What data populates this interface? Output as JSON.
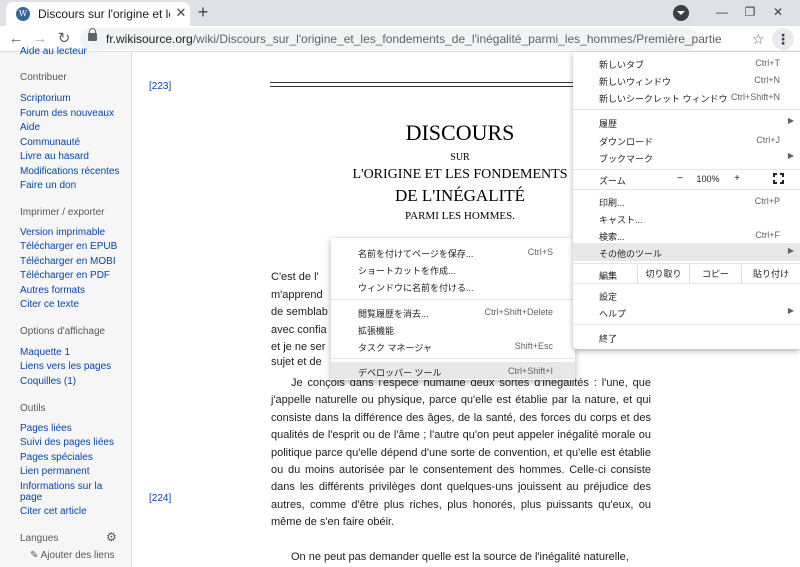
{
  "browser": {
    "tab_title": "Discours sur l'origine et les fondements",
    "favicon_letter": "W",
    "url_host": "fr.wikisource.org",
    "url_path": "/wiki/Discours_sur_l'origine_et_les_fondements_de_l'inégalité_parmi_les_hommes/Première_partie"
  },
  "sidebar": {
    "cut_link": "Aide au lecteur",
    "contribuer_heading": "Contribuer",
    "contribuer_items": [
      "Scriptorium",
      "Forum des nouveaux",
      "Aide",
      "Communauté",
      "Livre au hasard",
      "Modifications récentes",
      "Faire un don"
    ],
    "imprimer_heading": "Imprimer / exporter",
    "imprimer_items": [
      "Version imprimable",
      "Télécharger en EPUB",
      "Télécharger en MOBI",
      "Télécharger en PDF",
      "Autres formats",
      "Citer ce texte"
    ],
    "options_heading": "Options d'affichage",
    "options_items": [
      "Maquette 1",
      "Liens vers les pages",
      "Coquilles (1)"
    ],
    "outils_heading": "Outils",
    "outils_items": [
      "Pages liées",
      "Suivi des pages liées",
      "Pages spéciales",
      "Lien permanent",
      "Informations sur la page",
      "Citer cet article"
    ],
    "langues_heading": "Langues",
    "add_links": "Ajouter des liens"
  },
  "content": {
    "page_ref_1": "[223]",
    "page_ref_2": "[224]",
    "title": "DISCOURS",
    "sur": "SUR",
    "line1": "L'ORIGINE ET LES FONDEMENTS",
    "line2": "DE L'INÉGALITÉ",
    "line3": "PARMI LES HOMMES.",
    "partial_lines": [
      "C'est de l'",
      "m'apprend",
      "de semblab",
      "avec confia",
      "et je ne ser",
      "sujet et de"
    ],
    "paragraph1": "Je conçois dans l'espèce humaine deux sortes d'inégalités : l'une, que j'appelle naturelle ou physique, parce qu'elle est établie par la nature, et qui consiste dans la différence des âges, de la santé, des forces du corps et des qualités de l'esprit ou de l'âme ; l'autre qu'on peut appeler inégalité morale ou politique parce qu'elle dépend d'une sorte de convention, et qu'elle est établie ou du moins autorisée par le consentement des hommes. Celle-ci consiste dans les différents privilèges dont quelques-uns jouissent au préjudice des autres, comme d'être plus riches, plus honorés, plus puissants qu'eux, ou même de s'en faire obéir.",
    "paragraph2": "On ne peut pas demander quelle est la source de l'inégalité naturelle,"
  },
  "menu": {
    "new_tab": "新しいタブ",
    "new_tab_sc": "Ctrl+T",
    "new_window": "新しいウィンドウ",
    "new_window_sc": "Ctrl+N",
    "incognito": "新しいシークレット ウィンドウ",
    "incognito_sc": "Ctrl+Shift+N",
    "history": "履歴",
    "downloads": "ダウンロード",
    "downloads_sc": "Ctrl+J",
    "bookmarks": "ブックマーク",
    "zoom": "ズーム",
    "zoom_minus": "−",
    "zoom_value": "100%",
    "zoom_plus": "+",
    "print": "印刷...",
    "print_sc": "Ctrl+P",
    "cast": "キャスト...",
    "find": "検索...",
    "find_sc": "Ctrl+F",
    "more_tools": "その他のツール",
    "edit": "編集",
    "cut": "切り取り",
    "copy": "コピー",
    "paste": "貼り付け",
    "settings": "設定",
    "help": "ヘルプ",
    "exit": "終了"
  },
  "submenu": {
    "save_page": "名前を付けてページを保存...",
    "save_page_sc": "Ctrl+S",
    "create_shortcut": "ショートカットを作成...",
    "name_window": "ウィンドウに名前を付ける...",
    "clear_data": "閲覧履歴を消去...",
    "clear_data_sc": "Ctrl+Shift+Delete",
    "extensions": "拡張機能",
    "task_manager": "タスク マネージャ",
    "task_manager_sc": "Shift+Esc",
    "dev_tools": "デベロッパー ツール",
    "dev_tools_sc": "Ctrl+Shift+I"
  }
}
